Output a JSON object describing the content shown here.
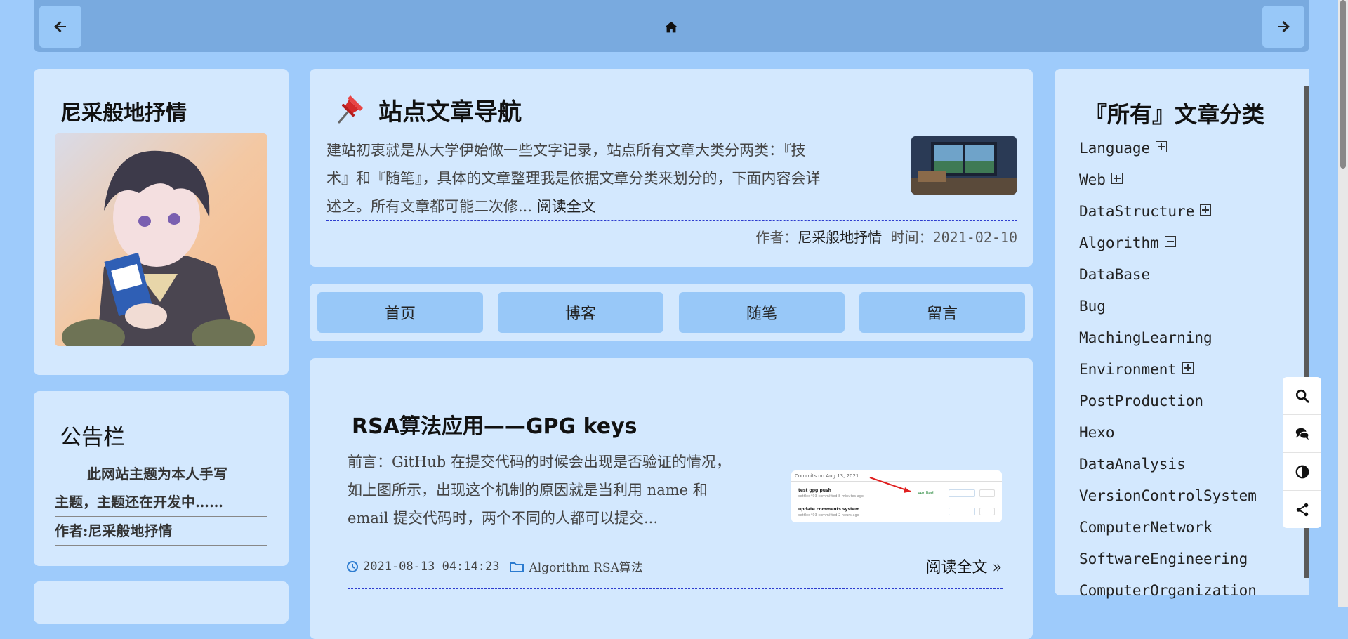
{
  "topbar": {
    "back_icon": "arrow-left-icon",
    "home_icon": "home-icon",
    "forward_icon": "arrow-right-icon"
  },
  "author_card": {
    "name": "尼采般地抒情"
  },
  "notice": {
    "title": "公告栏",
    "text": "此网站主题为本人手写主题，主题还在开发中……",
    "line1": "此网站主题为本人手写",
    "line2": "主题，主题还在开发中……",
    "author": "作者:尼采般地抒情"
  },
  "featured": {
    "title": "站点文章导航",
    "line1": "建站初衷就是从大学伊始做一些文字记录，站点所有文章大类分两类：『技",
    "line2": "术』和『随笔』，具体的文章整理我是依据文章分类来划分的，下面内容会详",
    "line3": "述之。所有文章都可能二次修...",
    "read_more": "阅读全文",
    "author_label": "作者：",
    "author": "尼采般地抒情",
    "time_label": "时间：",
    "time": "2021-02-10"
  },
  "tabs": [
    "首页",
    "博客",
    "随笔",
    "留言"
  ],
  "post": {
    "title": "RSA算法应用——GPG keys",
    "line1": "前言：GitHub 在提交代码的时候会出现是否验证的情况，",
    "line2": "如上图所示，出现这个机制的原因就是当利用 name 和",
    "line3": "email 提交代码时，两个不同的人都可以提交...",
    "date": "2021-08-13 04:14:23",
    "category": "Algorithm RSA算法",
    "read_more": "阅读全文 »",
    "thumb": {
      "header": "Commits on Aug 13, 2021",
      "commit1": "test gpg push",
      "commit1_meta": "settled493 committed 8 minutes ago",
      "verified": "Verified",
      "commit2": "update comments system",
      "commit2_meta": "settled493 committed 2 hours ago"
    }
  },
  "categories": {
    "title": "『所有』文章分类",
    "items": [
      {
        "label": "Language",
        "expandable": true
      },
      {
        "label": "Web",
        "expandable": true
      },
      {
        "label": "DataStructure",
        "expandable": true
      },
      {
        "label": "Algorithm",
        "expandable": true
      },
      {
        "label": "DataBase",
        "expandable": false
      },
      {
        "label": "Bug",
        "expandable": false
      },
      {
        "label": "MachingLearning",
        "expandable": false
      },
      {
        "label": "Environment",
        "expandable": true
      },
      {
        "label": "PostProduction",
        "expandable": false
      },
      {
        "label": "Hexo",
        "expandable": false
      },
      {
        "label": "DataAnalysis",
        "expandable": false
      },
      {
        "label": "VersionControlSystem",
        "expandable": false
      },
      {
        "label": "ComputerNetwork",
        "expandable": false
      },
      {
        "label": "SoftwareEngineering",
        "expandable": false
      },
      {
        "label": "ComputerOrganization",
        "expandable": false
      }
    ]
  },
  "toolbar": [
    "search-icon",
    "comments-icon",
    "contrast-icon",
    "share-icon"
  ],
  "colors": {
    "background": "#9ecbfb",
    "card": "#d3e8fe",
    "button": "#98c8f8",
    "topbar": "#79aadf",
    "accent": "#2b7bd0"
  }
}
